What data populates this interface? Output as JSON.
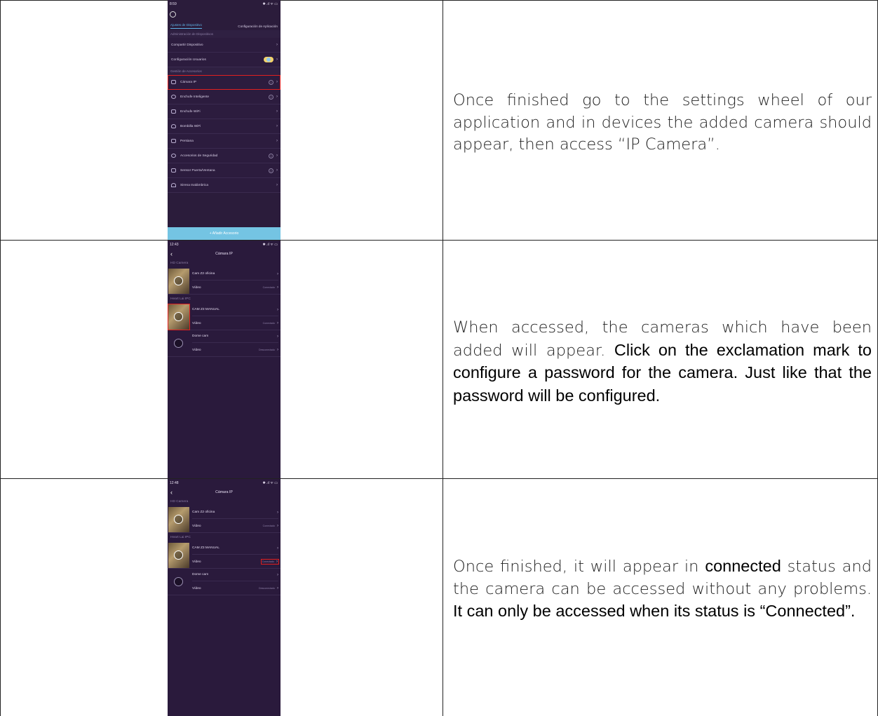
{
  "rows": [
    {
      "description": "Once finished go to the settings wheel of our application and in devices the added camera should appear, then access “IP Camera”."
    },
    {
      "description_plain": "When accessed, the cameras which have been added will appear.",
      "description_bold": "Click on the exclamation mark to configure a password for the camera. Just like that the password will be configured."
    },
    {
      "description_plain_1": "Once finished, it will appear in",
      "description_bold_1": "connected",
      "description_plain_2": "status and the camera can be accessed without any problems.",
      "description_bold_2": "It can only be accessed when its status is “Connected”."
    }
  ],
  "screen1": {
    "time": "8:59",
    "status_right": "✱ .ıl ᯤ ▭",
    "tabs": [
      "Ajustes de Dispositivo",
      "Configuración de Aplicación"
    ],
    "section_admin": "Administración de Dispositivos",
    "admin_items": [
      {
        "label": "Compartir Dispositivo"
      },
      {
        "label": "Configuración Usuarios"
      }
    ],
    "section_accessories": "Gestión de Accesorios",
    "accessory_items": [
      {
        "label": "Cámara IP",
        "badge": "1"
      },
      {
        "label": "Enchufe Inteligente",
        "badge": "2"
      },
      {
        "label": "Enchufe WiFi",
        "badge": ""
      },
      {
        "label": "Bombilla WiFi",
        "badge": ""
      },
      {
        "label": "Persiana",
        "badge": ""
      },
      {
        "label": "Accesorios de Seguridad",
        "badge": "1"
      },
      {
        "label": "Sensor Puerta/Ventana",
        "badge": "2"
      },
      {
        "label": "Sirena Inalámbrica",
        "badge": ""
      }
    ],
    "add_button": "+ Añadir Accesorio"
  },
  "screen2": {
    "time": "12:43",
    "status_right": "✱ .ıl ᯤ ▭",
    "title": "Cámara IP",
    "group1": "HD Camera",
    "group2": "Heart Lai IPC",
    "cams": [
      {
        "name": "Cam Z2 oficina",
        "sub": "Vídeo",
        "status": "Conectado"
      },
      {
        "name": "CAM Z3 MANUAL",
        "sub": "Vídeo",
        "status": "Conectado"
      },
      {
        "name": "Dome cam",
        "sub": "Vídeo",
        "status": "Desconectado"
      }
    ]
  },
  "screen3": {
    "time": "12:48",
    "status_right": "✱ .ıl ᯤ ▭",
    "title": "Cámara IP",
    "group1": "HD Camera",
    "group2": "Heart Lai IPC",
    "cams": [
      {
        "name": "Cam Z2 oficina",
        "sub": "Vídeo",
        "status": "Conectado"
      },
      {
        "name": "CAM Z3 MANUAL",
        "sub": "Vídeo",
        "status": "Conectado"
      },
      {
        "name": "Dome cam",
        "sub": "Vídeo",
        "status": "Desconectado"
      }
    ]
  },
  "colors": {
    "phone_bg": "#2a1a3c",
    "accent_blue": "#74c4e3",
    "highlight_red": "#e02020",
    "border": "#222222"
  }
}
